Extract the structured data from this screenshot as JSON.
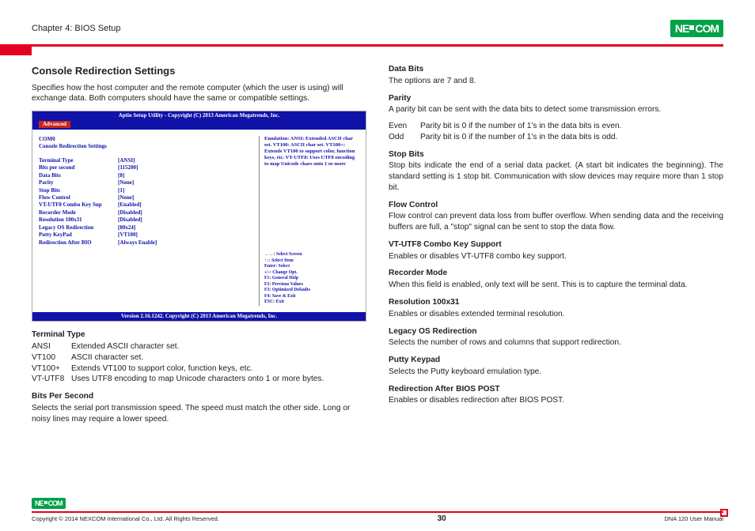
{
  "hdr": {
    "chapter": "Chapter 4: BIOS Setup",
    "logo": "NEXCOM"
  },
  "main": {
    "title": "Console Redirection Settings",
    "intro": "Specifies how the host computer and the remote computer (which the user is using) will exchange data. Both computers should have the same or compatible settings."
  },
  "bios": {
    "title": "Aptio Setup Utility - Copyright (C) 2013 American Megatrends, Inc.",
    "tab": "Advanced",
    "section1": "COM0",
    "section2": "Console Redirection Settings",
    "rows": [
      {
        "lbl": "Terminal Type",
        "val": "[ANSI]"
      },
      {
        "lbl": "Bits per second",
        "val": "[115200]"
      },
      {
        "lbl": "Data Bits",
        "val": "[8]"
      },
      {
        "lbl": "Parity",
        "val": "[None]"
      },
      {
        "lbl": "Stop Bits",
        "val": "[1]"
      },
      {
        "lbl": "Flow Control",
        "val": "[None]"
      },
      {
        "lbl": "VT-UTF8 Combo Key Sup",
        "val": "[Enabled]"
      },
      {
        "lbl": "Recorder Mode",
        "val": "[Disabled]"
      },
      {
        "lbl": "Resolution 100x31",
        "val": "[Disabled]"
      },
      {
        "lbl": "Legacy OS Redirection",
        "val": "[80x24]"
      },
      {
        "lbl": "Putty KeyPad",
        "val": "[VT100]"
      },
      {
        "lbl": "Redirection After BIO",
        "val": "[Always Enable]"
      }
    ],
    "help": "Emulation: ANSI: Extended ASCII char set. VT100: ASCII char set. VT100+: Extends VT100 to support color, function keys, etc. VT-UTF8: Uses UTF8 encoding to map Unicode chars onto 1 or more",
    "keys": [
      "→←: Select Screen",
      "↑↓: Select Item",
      "Enter: Select",
      "+/-: Change Opt.",
      "F1: General Help",
      "F2: Previous Values",
      "F3: Optimized Defaults",
      "F4: Save & Exit",
      "ESC: Exit"
    ],
    "ver": "Version 2.16.1242. Copyright (C) 2013 American Megatrends, Inc."
  },
  "left": {
    "tt": {
      "h": "Terminal Type",
      "rows": [
        {
          "k": "ANSI",
          "v": "Extended ASCII character set."
        },
        {
          "k": "VT100",
          "v": "ASCII character set."
        },
        {
          "k": "VT100+",
          "v": "Extends VT100 to support color, function keys, etc."
        },
        {
          "k": "VT-UTF8",
          "v": "Uses UTF8 encoding to map Unicode characters onto 1 or more bytes."
        }
      ]
    },
    "bps": {
      "h": "Bits Per Second",
      "p": "Selects the serial port transmission speed. The speed must match the other side. Long or noisy lines may require a lower speed."
    }
  },
  "right": {
    "db": {
      "h": "Data Bits",
      "p": "The options are 7 and 8."
    },
    "par": {
      "h": "Parity",
      "p": "A parity bit can be sent with the data bits to detect some transmission errors.",
      "rows": [
        {
          "k": "Even",
          "v": "Parity bit is 0 if the number of 1's in the data bits is even."
        },
        {
          "k": "Odd",
          "v": "Parity bit is 0 if the number of 1's in the data bits is odd."
        }
      ]
    },
    "sb": {
      "h": "Stop Bits",
      "p": "Stop bits indicate the end of a serial data packet. (A start bit indicates the beginning). The standard setting is 1 stop bit. Communication with slow devices may require more than 1 stop bit."
    },
    "fc": {
      "h": "Flow Control",
      "p": "Flow control can prevent data loss from buffer overflow. When sending data and the receiving buffers are full, a \"stop\" signal can be sent to stop the data flow."
    },
    "vt": {
      "h": "VT-UTF8 Combo Key Support",
      "p": "Enables or disables VT-UTF8 combo key support."
    },
    "rm": {
      "h": "Recorder Mode",
      "p": "When this field is enabled, only text will be sent. This is to capture the terminal data."
    },
    "res": {
      "h": "Resolution 100x31",
      "p": "Enables or disables extended terminal resolution."
    },
    "leg": {
      "h": "Legacy OS Redirection",
      "p": "Selects the number of rows and columns that support redirection."
    },
    "pk": {
      "h": "Putty Keypad",
      "p": "Selects the Putty keyboard emulation type."
    },
    "rab": {
      "h": "Redirection After BIOS POST",
      "p": "Enables or disables redirection after BIOS POST."
    }
  },
  "ftr": {
    "copy": "Copyright © 2014 NEXCOM International Co., Ltd. All Rights Reserved.",
    "page": "30",
    "doc": "DNA 120 User Manual"
  }
}
